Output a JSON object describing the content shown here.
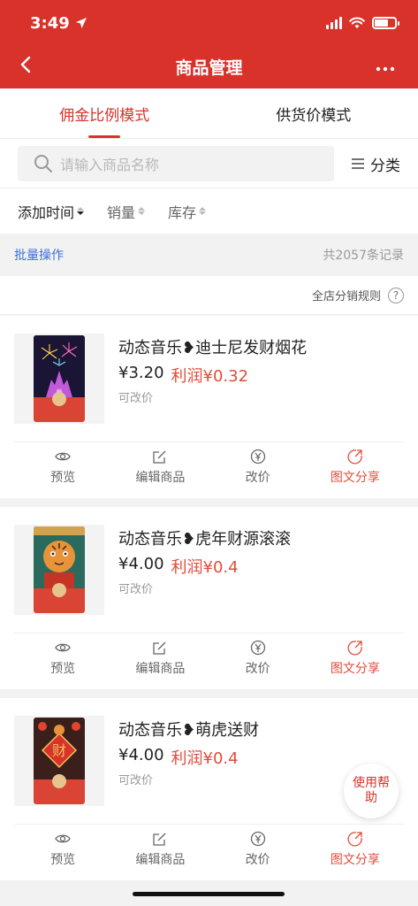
{
  "status_bar": {
    "time": "3:49"
  },
  "navbar": {
    "title": "商品管理"
  },
  "tabs": [
    {
      "label": "佣金比例模式",
      "active": true
    },
    {
      "label": "供货价模式",
      "active": false
    }
  ],
  "search": {
    "placeholder": "请输入商品名称",
    "category_label": "分类"
  },
  "sort": [
    {
      "label": "添加时间",
      "active": true
    },
    {
      "label": "销量",
      "active": false
    },
    {
      "label": "库存",
      "active": false
    }
  ],
  "batch": {
    "label": "批量操作",
    "total": "共2057条记录"
  },
  "rules": {
    "label": "全店分销规则",
    "help": "?"
  },
  "products": [
    {
      "name": "动态音乐❥迪士尼发财烟花",
      "price": "¥3.20",
      "profit": "利润¥0.32",
      "tip": "可改价",
      "art": "fireworks"
    },
    {
      "name": "动态音乐❥虎年财源滚滚",
      "price": "¥4.00",
      "profit": "利润¥0.4",
      "tip": "可改价",
      "art": "tiger"
    },
    {
      "name": "动态音乐❥萌虎送财",
      "price": "¥4.00",
      "profit": "利润¥0.4",
      "tip": "可改价",
      "art": "cai"
    }
  ],
  "actions": {
    "preview": "预览",
    "edit": "编辑商品",
    "price": "改价",
    "share": "图文分享"
  },
  "floating_help": "使用帮助",
  "colors": {
    "brand": "#d8322b",
    "profit": "#e24b3a",
    "link": "#3b6fd8"
  }
}
